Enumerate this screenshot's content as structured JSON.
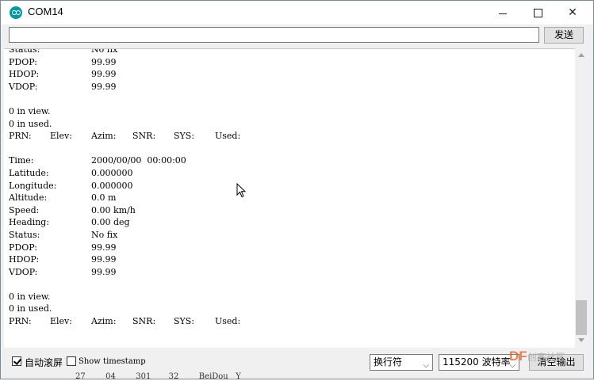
{
  "window": {
    "title": "COM14",
    "minimize_label": "–",
    "close_label": "✕"
  },
  "send": {
    "button_label": "发送",
    "input_value": ""
  },
  "output": {
    "lines": [
      {
        "key": "Status:",
        "value": "No fix"
      },
      {
        "key": "PDOP:",
        "value": "99.99"
      },
      {
        "key": "HDOP:",
        "value": "99.99"
      },
      {
        "key": "VDOP:",
        "value": "99.99"
      },
      {
        "key": "",
        "value": ""
      },
      {
        "key": "0 in view.",
        "value": ""
      },
      {
        "key": "0 in used.",
        "value": ""
      },
      {
        "header": [
          "PRN:",
          "Elev:",
          "Azim:",
          "SNR:",
          "SYS:",
          "Used:"
        ]
      },
      {
        "key": "",
        "value": ""
      },
      {
        "key": "Time:",
        "value": "2000/00/00  00:00:00"
      },
      {
        "key": "Latitude:",
        "value": "0.000000"
      },
      {
        "key": "Longitude:",
        "value": "0.000000"
      },
      {
        "key": "Altitude:",
        "value": "0.0 m"
      },
      {
        "key": "Speed:",
        "value": "0.00 km/h"
      },
      {
        "key": "Heading:",
        "value": "0.00 deg"
      },
      {
        "key": "Status:",
        "value": "No fix"
      },
      {
        "key": "PDOP:",
        "value": "99.99"
      },
      {
        "key": "HDOP:",
        "value": "99.99"
      },
      {
        "key": "VDOP:",
        "value": "99.99"
      },
      {
        "key": "",
        "value": ""
      },
      {
        "key": "0 in view.",
        "value": ""
      },
      {
        "key": "0 in used.",
        "value": ""
      },
      {
        "header": [
          "PRN:",
          "Elev:",
          "Azim:",
          "SNR:",
          "SYS:",
          "Used:"
        ]
      }
    ]
  },
  "status_bar": {
    "autoscroll": {
      "label": "自动滚屏",
      "checked": true
    },
    "timestamp": {
      "label": "Show timestamp",
      "checked": false
    },
    "line_ending": "换行符",
    "baud_rate": "115200 波特率",
    "clear_label": "清空输出"
  },
  "background_text": "27        04        301       32        BeiDou   Y",
  "watermark": {
    "brand": "DF",
    "text": "创客社区"
  }
}
